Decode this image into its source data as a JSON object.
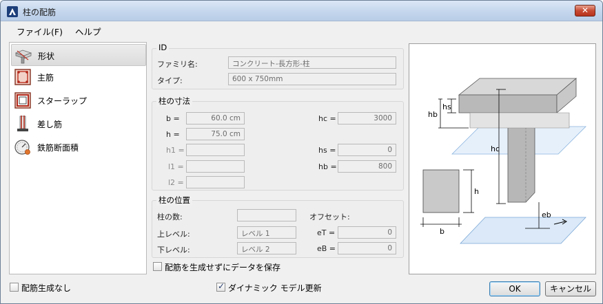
{
  "window": {
    "title": "柱の配筋",
    "close_glyph": "✕"
  },
  "menu": {
    "file": "ファイル(F)",
    "help": "ヘルプ"
  },
  "nav": {
    "items": [
      {
        "label": "形状",
        "icon": "shape-icon"
      },
      {
        "label": "主筋",
        "icon": "main-rebar-icon"
      },
      {
        "label": "スターラップ",
        "icon": "stirrup-icon"
      },
      {
        "label": "差し筋",
        "icon": "dowel-icon"
      },
      {
        "label": "鉄筋断面積",
        "icon": "rebar-area-icon"
      }
    ]
  },
  "id_group": {
    "title": "ID",
    "family_label": "ファミリ名:",
    "family_value": "コンクリート-長方形-柱",
    "type_label": "タイプ:",
    "type_value": "600 x 750mm"
  },
  "dims_group": {
    "title": "柱の寸法",
    "b_label": "b =",
    "b_value": "60.0 cm",
    "h_label": "h =",
    "h_value": "75.0 cm",
    "h1_label": "h1 =",
    "h1_value": "",
    "l1_label": "l1 =",
    "l1_value": "",
    "l2_label": "l2 =",
    "l2_value": "",
    "hc_label": "hc =",
    "hc_value": "3000",
    "hs_label": "hs =",
    "hs_value": "0",
    "hb_label": "hb =",
    "hb_value": "800"
  },
  "position_group": {
    "title": "柱の位置",
    "count_label": "柱の数:",
    "count_value": "",
    "offset_label": "オフセット:",
    "upper_label": "上レベル:",
    "upper_value": "レベル 1",
    "lower_label": "下レベル:",
    "lower_value": "レベル 2",
    "et_label": "eT =",
    "et_value": "0",
    "eb_label": "eB =",
    "eb_value": "0"
  },
  "save_data_label": "配筋を生成せずにデータを保存",
  "no_rebar_label": "配筋生成なし",
  "dynamic_update_label": "ダイナミック モデル更新",
  "diagram": {
    "hs": "hs",
    "hb": "hb",
    "hc": "hc",
    "h": "h",
    "b": "b",
    "eb": "eb"
  },
  "buttons": {
    "ok": "OK",
    "cancel": "キャンセル"
  },
  "colors": {
    "accent": "#3c7fb1",
    "title_gradient": "#c3d5ec",
    "close_red": "#c74a33"
  }
}
